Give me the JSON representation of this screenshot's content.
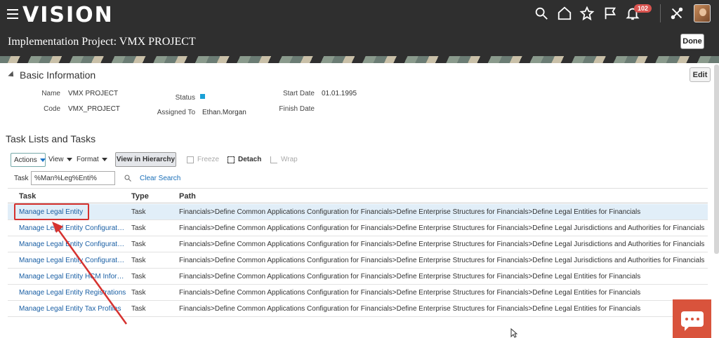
{
  "header": {
    "brand": "VISION",
    "notification_count": "102",
    "page_title": "Implementation Project: VMX PROJECT",
    "done_label": "Done"
  },
  "basic_info": {
    "title": "Basic Information",
    "edit_label": "Edit",
    "name_label": "Name",
    "name_value": "VMX PROJECT",
    "code_label": "Code",
    "code_value": "VMX_PROJECT",
    "status_label": "Status",
    "assigned_label": "Assigned To",
    "assigned_value": "Ethan.Morgan",
    "start_label": "Start Date",
    "start_value": "01.01.1995",
    "finish_label": "Finish Date",
    "status_color": "#1aa0d6"
  },
  "tasks": {
    "title": "Task Lists and Tasks",
    "toolbar": {
      "actions": "Actions",
      "view": "View",
      "format": "Format",
      "view_hierarchy": "View in Hierarchy",
      "freeze": "Freeze",
      "detach": "Detach",
      "wrap": "Wrap"
    },
    "search": {
      "label": "Task",
      "value": "%Man%Leg%Enti%",
      "clear": "Clear Search"
    },
    "columns": [
      "Task",
      "Type",
      "Path"
    ],
    "rows": [
      {
        "task": "Manage Legal Entity",
        "type": "Task",
        "path": "Financials>Define Common Applications Configuration for Financials>Define Enterprise Structures for Financials>Define Legal Entities for Financials"
      },
      {
        "task": "Manage Legal Entity Configurator Options",
        "type": "Task",
        "path": "Financials>Define Common Applications Configuration for Financials>Define Enterprise Structures for Financials>Define Legal Jurisdictions and Authorities for Financials"
      },
      {
        "task": "Manage Legal Entity Configurator Rules",
        "type": "Task",
        "path": "Financials>Define Common Applications Configuration for Financials>Define Enterprise Structures for Financials>Define Legal Jurisdictions and Authorities for Financials"
      },
      {
        "task": "Manage Legal Entity Configurator Setup",
        "type": "Task",
        "path": "Financials>Define Common Applications Configuration for Financials>Define Enterprise Structures for Financials>Define Legal Jurisdictions and Authorities for Financials"
      },
      {
        "task": "Manage Legal Entity HCM Information",
        "type": "Task",
        "path": "Financials>Define Common Applications Configuration for Financials>Define Enterprise Structures for Financials>Define Legal Entities for Financials"
      },
      {
        "task": "Manage Legal Entity Registrations",
        "type": "Task",
        "path": "Financials>Define Common Applications Configuration for Financials>Define Enterprise Structures for Financials>Define Legal Entities for Financials"
      },
      {
        "task": "Manage Legal Entity Tax Profiles",
        "type": "Task",
        "path": "Financials>Define Common Applications Configuration for Financials>Define Enterprise Structures for Financials>Define Legal Entities for Financials"
      }
    ]
  },
  "colors": {
    "header_bg": "#2f2f2f",
    "link": "#1a5fa4",
    "highlight": "#d6322f",
    "chat": "#d9533c"
  }
}
